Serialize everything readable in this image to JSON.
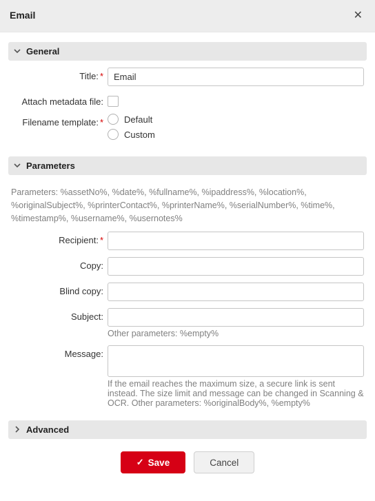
{
  "header": {
    "title": "Email"
  },
  "sections": {
    "general": {
      "title": "General",
      "title_label": "Title:",
      "title_value": "Email",
      "attach_metadata_label": "Attach metadata file:",
      "filename_template_label": "Filename template:",
      "filename_default": "Default",
      "filename_custom": "Custom"
    },
    "parameters": {
      "title": "Parameters",
      "help": "Parameters: %assetNo%, %date%, %fullname%, %ipaddress%, %location%, %originalSubject%, %printerContact%, %printerName%, %serialNumber%, %time%, %timestamp%, %username%, %usernotes%",
      "recipient_label": "Recipient:",
      "copy_label": "Copy:",
      "blind_copy_label": "Blind copy:",
      "subject_label": "Subject:",
      "subject_help": "Other parameters: %empty%",
      "message_label": "Message:",
      "message_help": "If the email reaches the maximum size, a secure link is sent instead. The size limit and message can be changed in Scanning & OCR. Other parameters: %originalBody%, %empty%"
    },
    "advanced": {
      "title": "Advanced"
    }
  },
  "footer": {
    "save": "Save",
    "cancel": "Cancel"
  }
}
